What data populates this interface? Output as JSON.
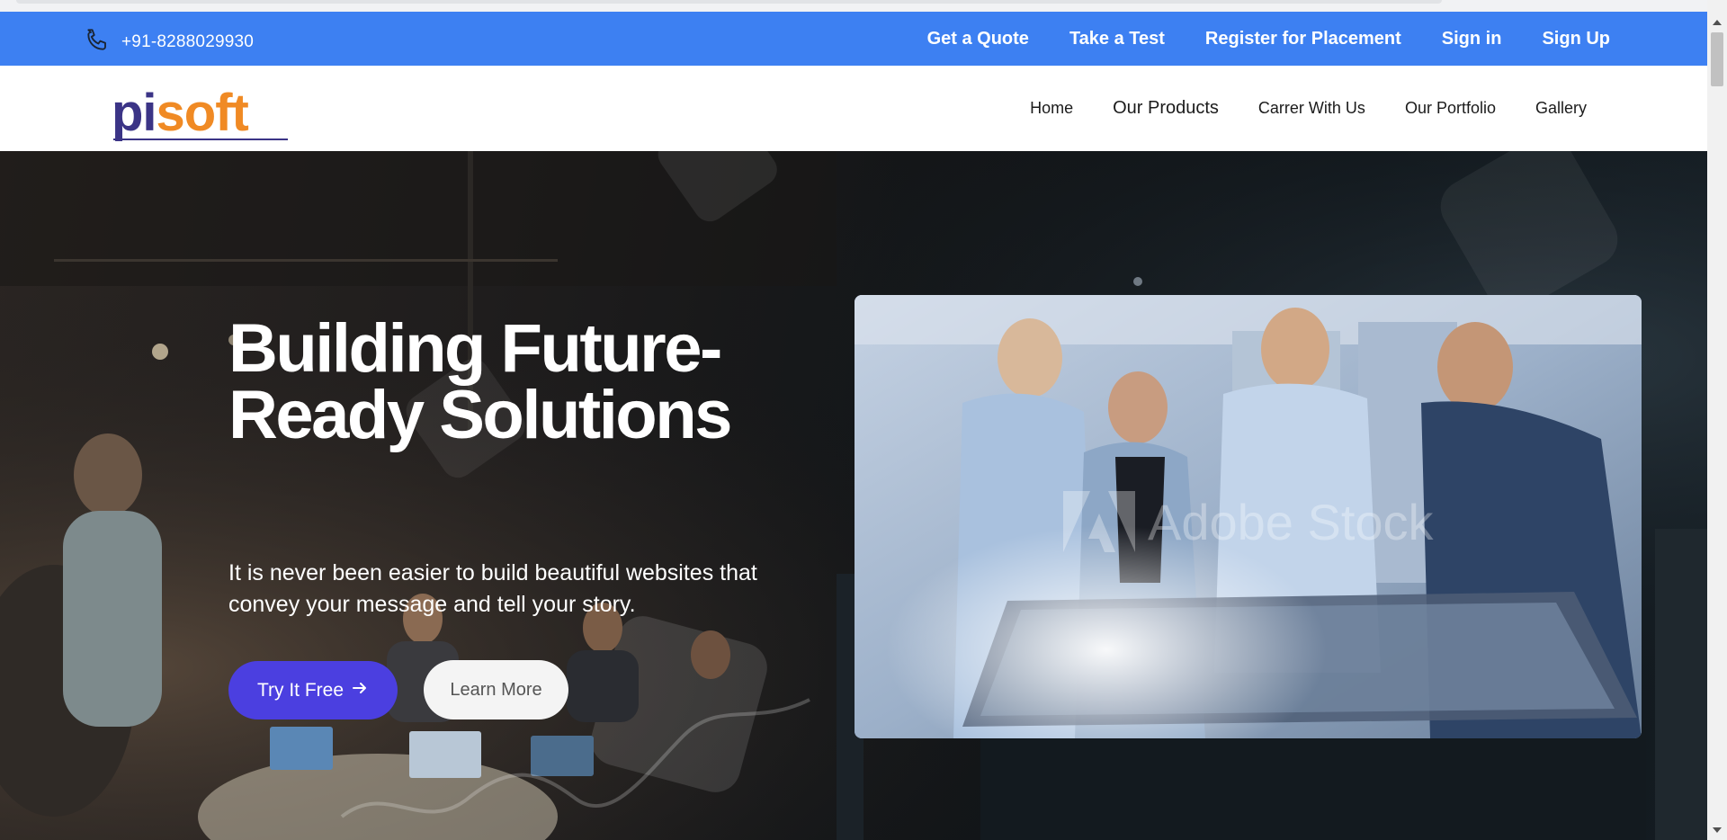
{
  "topbar": {
    "phone_icon": "phone-icon",
    "phone": "+91-8288029930",
    "links": [
      "Get a Quote",
      "Take a Test",
      "Register for Placement",
      "Sign in",
      "Sign Up"
    ]
  },
  "navbar": {
    "logo_text": "pisoft",
    "items": [
      "Home",
      "Our Products",
      "Carrer With Us",
      "Our Portfolio",
      "Gallery"
    ]
  },
  "hero": {
    "title": "Building Future-Ready Solutions",
    "subtitle": "It is never been easier to build beautiful websites that convey your message and tell your story.",
    "primary_button": "Try It Free",
    "primary_button_icon": "arrow-right-icon",
    "secondary_button": "Learn More",
    "image_watermark": "Adobe Stock"
  },
  "colors": {
    "topbar_bg": "#3d80f2",
    "primary_button": "#4b3fe0",
    "logo_pi": "#3b3486",
    "logo_soft": "#f08a24"
  }
}
